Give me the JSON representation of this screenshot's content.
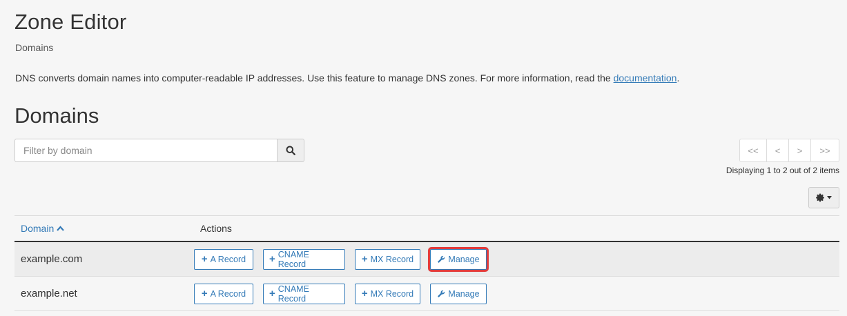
{
  "header": {
    "title": "Zone Editor",
    "subtitle": "Domains",
    "description_text": "DNS converts domain names into computer-readable IP addresses. Use this feature to manage DNS zones. For more information, read the ",
    "description_link": "documentation",
    "description_end": "."
  },
  "section": {
    "heading": "Domains"
  },
  "search": {
    "placeholder": "Filter by domain",
    "value": ""
  },
  "pagination": {
    "first": "<<",
    "prev": "<",
    "next": ">",
    "last": ">>",
    "status": "Displaying 1 to 2 out of 2 items"
  },
  "table": {
    "columns": {
      "domain": "Domain",
      "actions": "Actions"
    },
    "rows": [
      {
        "domain": "example.com",
        "a_record": "A Record",
        "cname_record": "CNAME Record",
        "mx_record": "MX Record",
        "manage": "Manage"
      },
      {
        "domain": "example.net",
        "a_record": "A Record",
        "cname_record": "CNAME Record",
        "mx_record": "MX Record",
        "manage": "Manage"
      }
    ]
  },
  "colors": {
    "accent": "#337ab7",
    "highlight": "#e23b3b"
  }
}
